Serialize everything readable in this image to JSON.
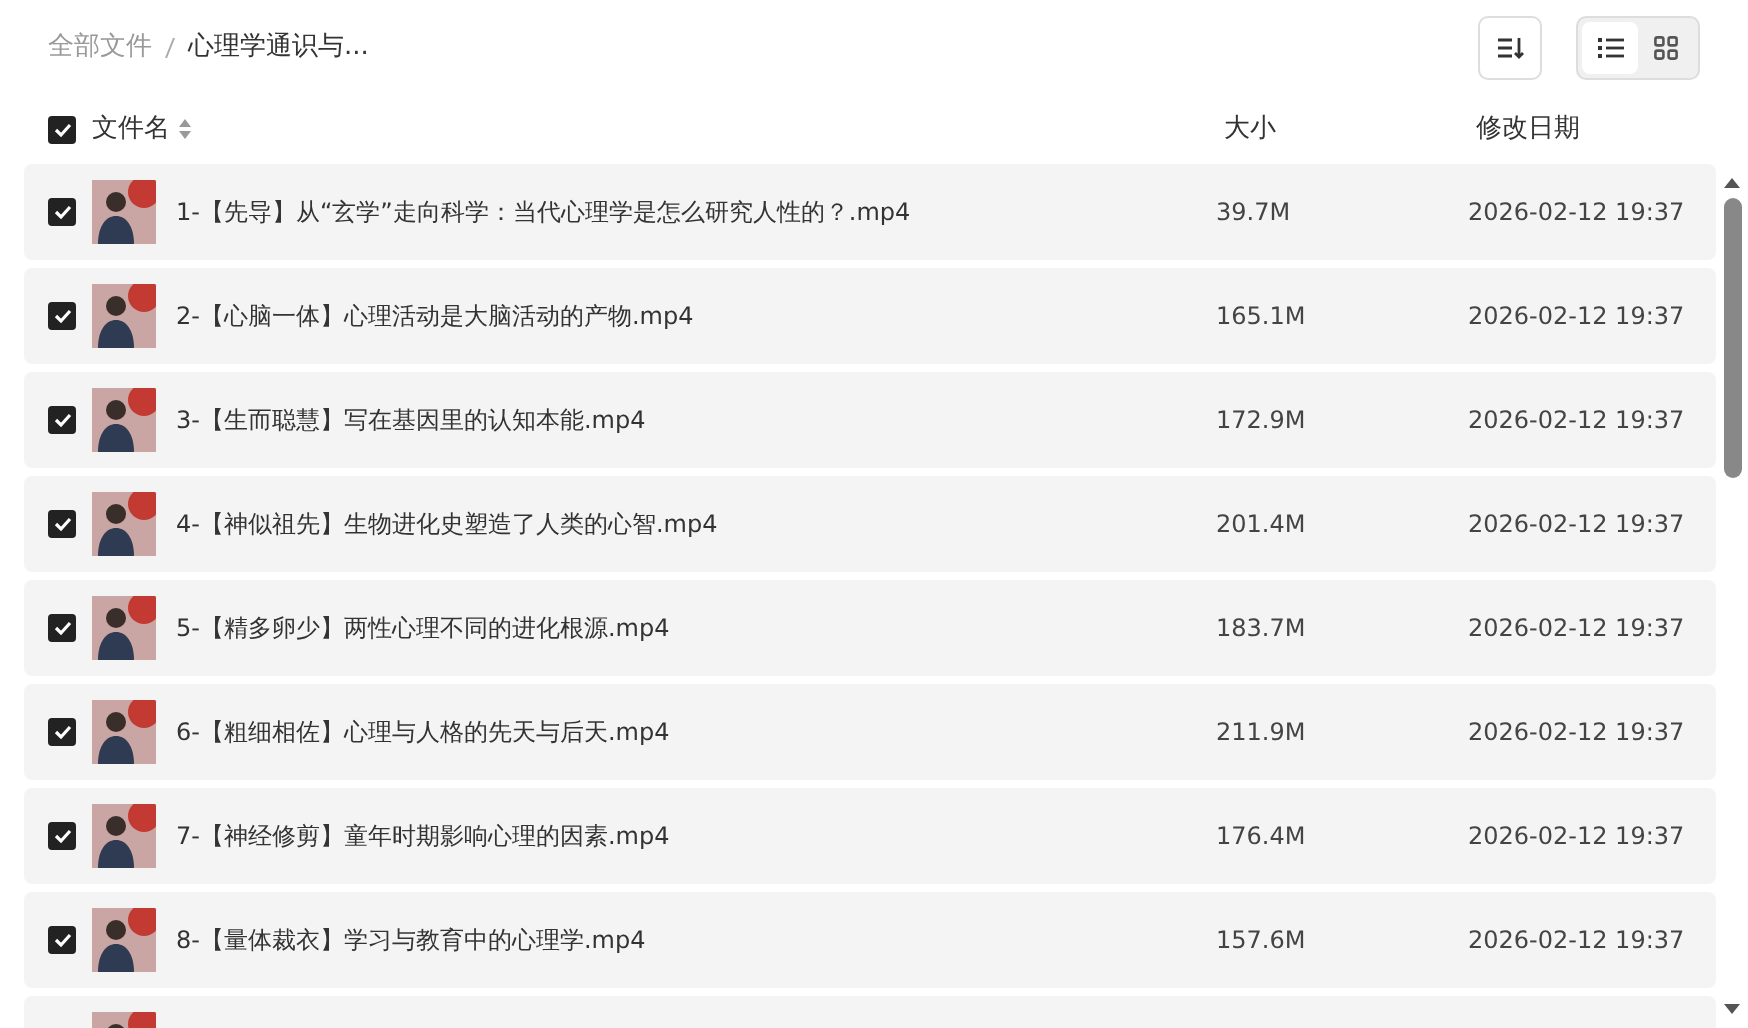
{
  "breadcrumb": [
    {
      "label": "全部文件",
      "current": false
    },
    {
      "label": "心理学通识与...",
      "current": true
    }
  ],
  "view_modes": [
    {
      "kind": "list",
      "selected": true
    },
    {
      "kind": "grid",
      "selected": false
    }
  ],
  "table": {
    "select_all": {
      "checked": true
    },
    "columns": [
      "文件名",
      "大小",
      "修改日期"
    ],
    "rows": [
      {
        "checked": true,
        "name": "1-【先导】从“玄学”走向科学：当代心理学是怎么研究人性的？.mp4",
        "size": "39.7M",
        "modified": "2026-02-12 19:37"
      },
      {
        "checked": true,
        "name": "2-【心脑一体】心理活动是大脑活动的产物.mp4",
        "size": "165.1M",
        "modified": "2026-02-12 19:37"
      },
      {
        "checked": true,
        "name": "3-【生而聪慧】写在基因里的认知本能.mp4",
        "size": "172.9M",
        "modified": "2026-02-12 19:37"
      },
      {
        "checked": true,
        "name": "4-【神似祖先】生物进化史塑造了人类的心智.mp4",
        "size": "201.4M",
        "modified": "2026-02-12 19:37"
      },
      {
        "checked": true,
        "name": "5-【精多卵少】两性心理不同的进化根源.mp4",
        "size": "183.7M",
        "modified": "2026-02-12 19:37"
      },
      {
        "checked": true,
        "name": "6-【粗细相佐】心理与人格的先天与后天.mp4",
        "size": "211.9M",
        "modified": "2026-02-12 19:37"
      },
      {
        "checked": true,
        "name": "7-【神经修剪】童年时期影响心理的因素.mp4",
        "size": "176.4M",
        "modified": "2026-02-12 19:37"
      },
      {
        "checked": true,
        "name": "8-【量体裁衣】学习与教育中的心理学.mp4",
        "size": "157.6M",
        "modified": "2026-02-12 19:37"
      },
      {}
    ]
  }
}
